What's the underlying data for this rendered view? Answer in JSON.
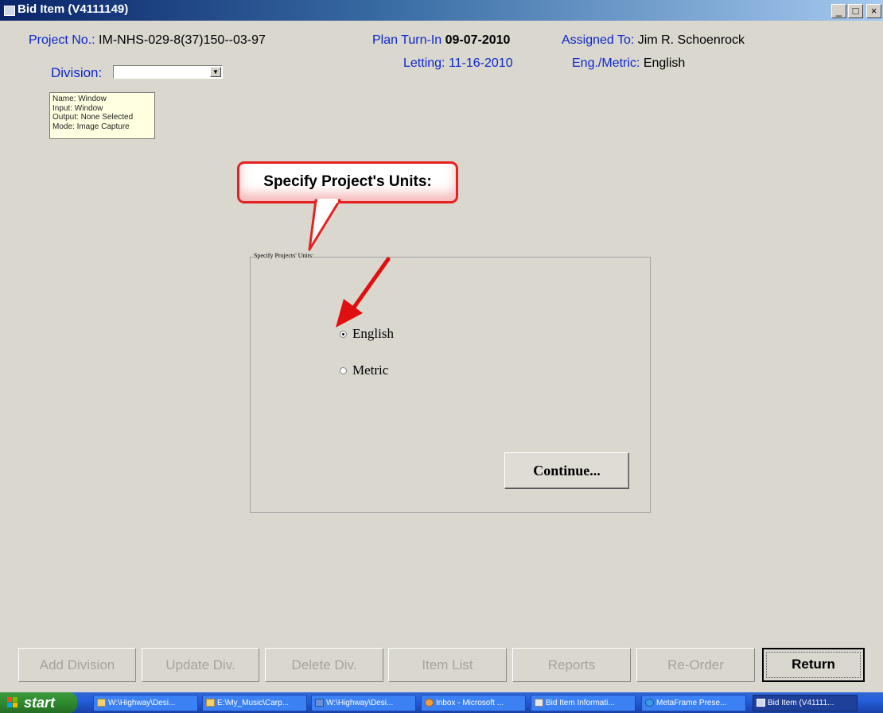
{
  "window": {
    "title": "Bid Item (V4111149)",
    "controls": {
      "minimize": "_",
      "maximize": "□",
      "close": "×"
    }
  },
  "header": {
    "project_label": "Project No.:",
    "project_value": "IM-NHS-029-8(37)150--03-97",
    "plan_label": "Plan Turn-In",
    "plan_value": "09-07-2010",
    "assigned_label": "Assigned To:",
    "assigned_value": "Jim R. Schoenrock",
    "letting_label": "Letting:",
    "letting_value": "11-16-2010",
    "units_label": "Eng./Metric:",
    "units_value": "English",
    "division_label": "Division:",
    "division_value": ""
  },
  "tooltip": {
    "lines": [
      "Name: Window",
      "Input: Window",
      "Output: None Selected",
      "Mode: Image Capture"
    ]
  },
  "callout": {
    "text": "Specify Project's Units:"
  },
  "unit_group": {
    "legend": "Specify Projects' Units:",
    "options": [
      {
        "label": "English",
        "checked": true
      },
      {
        "label": "Metric",
        "checked": false
      }
    ],
    "continue_label": "Continue..."
  },
  "bottom_buttons": {
    "add_division": "Add Division",
    "update_div": "Update Div.",
    "delete_div": "Delete Div.",
    "item_list": "Item List",
    "reports": "Reports",
    "reorder": "Re-Order",
    "return": "Return"
  },
  "taskbar": {
    "start": "start",
    "tasks": [
      "W:\\Highway\\Desi...",
      "E:\\My_Music\\Carp...",
      "W:\\Highway\\Desi...",
      "Inbox - Microsoft ...",
      "Bid Item Informati...",
      "MetaFrame Prese...",
      "Bid Item (V41111..."
    ]
  },
  "colors": {
    "label_blue": "#0b27d1",
    "callout_red": "#e42222",
    "arrow_red": "#e01010"
  }
}
